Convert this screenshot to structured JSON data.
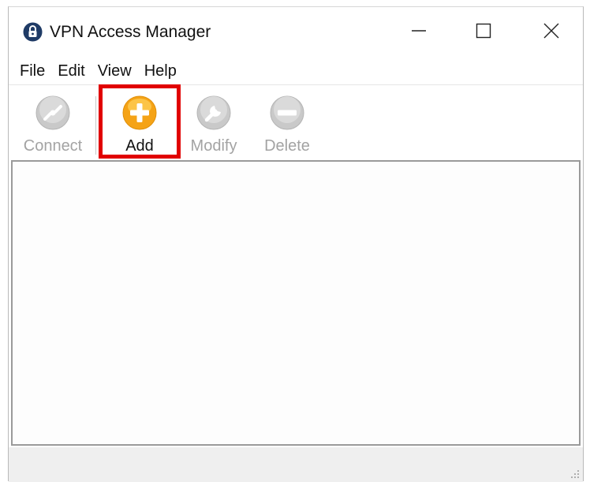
{
  "window": {
    "title": "VPN Access Manager",
    "app_icon": "lock-icon",
    "controls": [
      "minimize-icon",
      "maximize-icon",
      "close-icon"
    ]
  },
  "menu": [
    "File",
    "Edit",
    "View",
    "Help"
  ],
  "toolbar": {
    "items": [
      {
        "label": "Connect",
        "icon": "connect-icon",
        "enabled": false
      },
      {
        "label": "Add",
        "icon": "add-icon",
        "enabled": true
      },
      {
        "label": "Modify",
        "icon": "wrench-icon",
        "enabled": false
      },
      {
        "label": "Delete",
        "icon": "minus-circle-icon",
        "enabled": false
      }
    ]
  },
  "colors": {
    "highlight": "#e10000",
    "add_accent": "#f5a316",
    "disabled": "#a3a3a3"
  }
}
